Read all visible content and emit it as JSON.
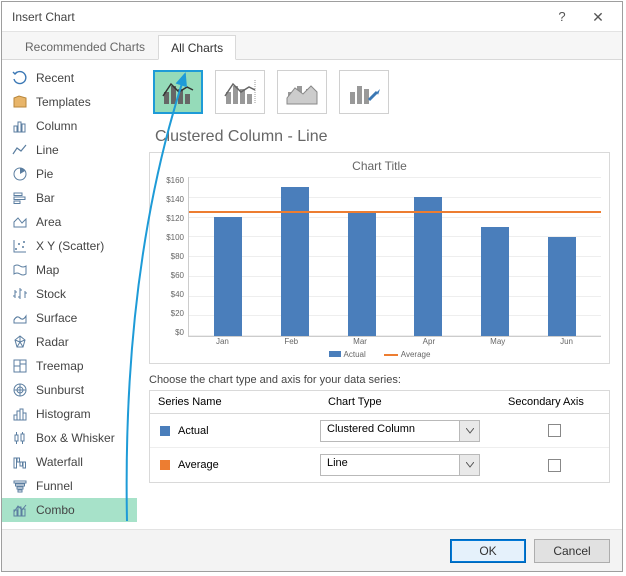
{
  "title": "Insert Chart",
  "titlebar": {
    "help": "?",
    "close": "✕"
  },
  "tabs": [
    {
      "label": "Recommended Charts",
      "active": false
    },
    {
      "label": "All Charts",
      "active": true
    }
  ],
  "sidebar": {
    "items": [
      {
        "label": "Recent"
      },
      {
        "label": "Templates"
      },
      {
        "label": "Column"
      },
      {
        "label": "Line"
      },
      {
        "label": "Pie"
      },
      {
        "label": "Bar"
      },
      {
        "label": "Area"
      },
      {
        "label": "X Y (Scatter)"
      },
      {
        "label": "Map"
      },
      {
        "label": "Stock"
      },
      {
        "label": "Surface"
      },
      {
        "label": "Radar"
      },
      {
        "label": "Treemap"
      },
      {
        "label": "Sunburst"
      },
      {
        "label": "Histogram"
      },
      {
        "label": "Box & Whisker"
      },
      {
        "label": "Waterfall"
      },
      {
        "label": "Funnel"
      },
      {
        "label": "Combo"
      }
    ],
    "selected": 18
  },
  "chart_subtype_name": "Clustered Column - Line",
  "preview_title": "Chart Title",
  "series_config": {
    "heading": "Choose the chart type and axis for your data series:",
    "cols": {
      "name": "Series Name",
      "type": "Chart Type",
      "axis": "Secondary Axis"
    },
    "rows": [
      {
        "name": "Actual",
        "type": "Clustered Column",
        "color": "#4a7ebb",
        "secondary": false
      },
      {
        "name": "Average",
        "type": "Line",
        "color": "#ed7d31",
        "secondary": false
      }
    ]
  },
  "buttons": {
    "ok": "OK",
    "cancel": "Cancel"
  },
  "chart_data": {
    "type": "combo",
    "title": "Chart Title",
    "xlabel": "",
    "ylabel": "",
    "ylim": [
      0,
      160
    ],
    "yticks": [
      0,
      20,
      40,
      60,
      80,
      100,
      120,
      140,
      160
    ],
    "ytick_labels": [
      "$0",
      "$20",
      "$40",
      "$60",
      "$80",
      "$100",
      "$120",
      "$140",
      "$160"
    ],
    "categories": [
      "Jan",
      "Feb",
      "Mar",
      "Apr",
      "May",
      "Jun"
    ],
    "series": [
      {
        "name": "Actual",
        "type": "bar",
        "color": "#4a7ebb",
        "values": [
          120,
          150,
          125,
          140,
          110,
          100
        ]
      },
      {
        "name": "Average",
        "type": "line",
        "color": "#ed7d31",
        "values": [
          124,
          124,
          124,
          124,
          124,
          124
        ]
      }
    ],
    "legend": [
      "Actual",
      "Average"
    ]
  }
}
